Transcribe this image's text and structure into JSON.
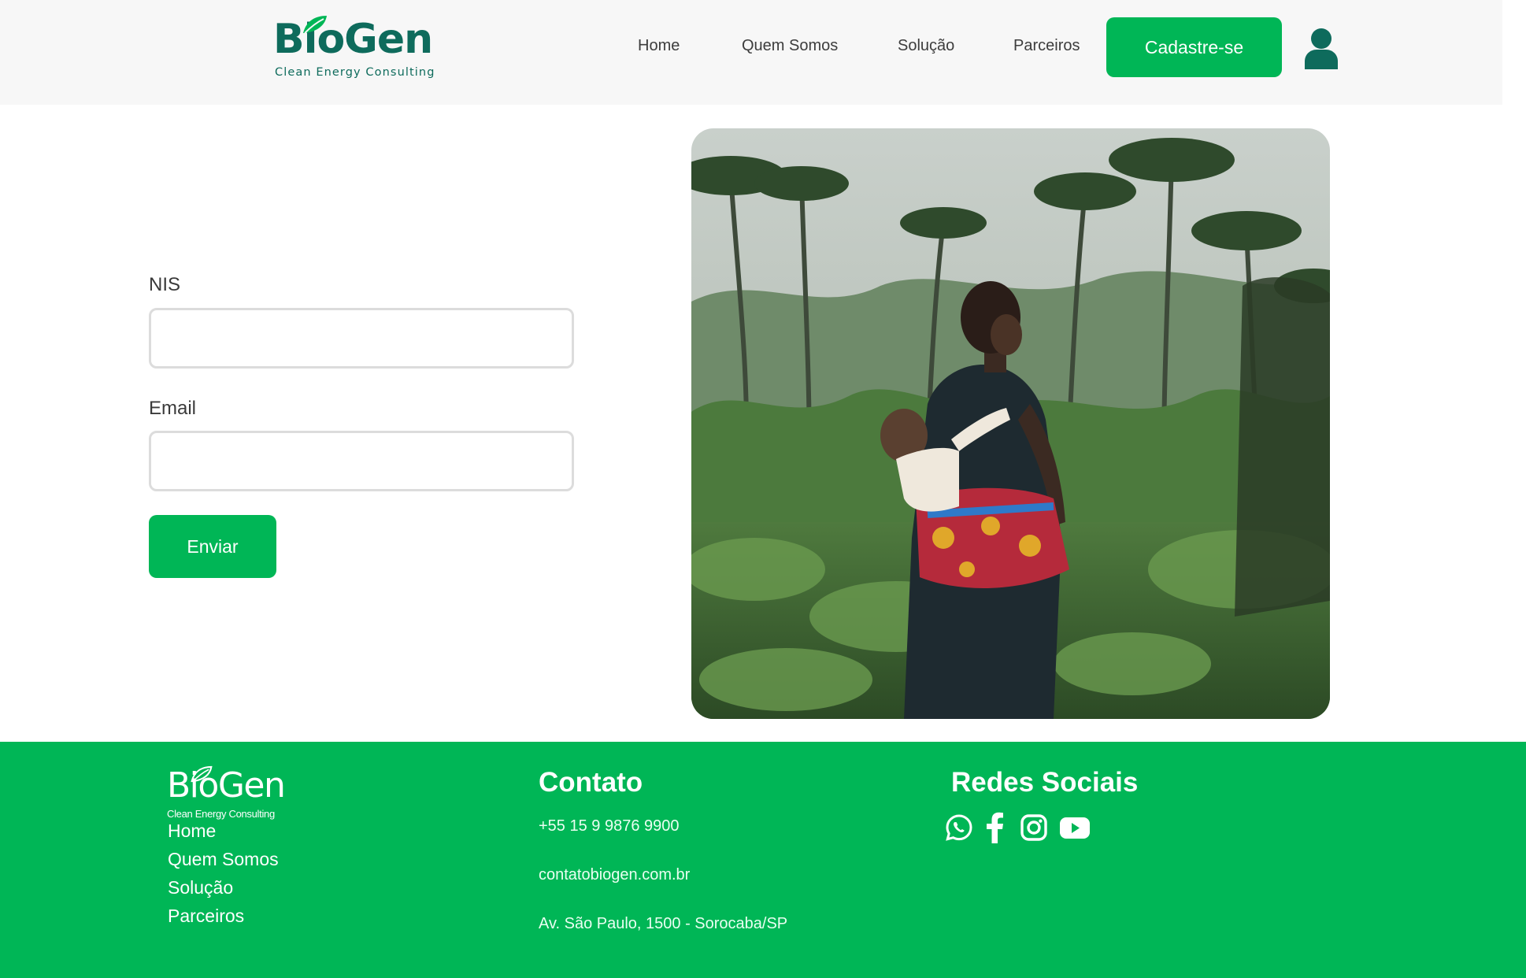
{
  "header": {
    "logo_text": "BioGen",
    "logo_tagline": "Clean Energy Consulting",
    "nav": [
      "Home",
      "Quem Somos",
      "Solução",
      "Parceiros"
    ],
    "signup_label": "Cadastre-se"
  },
  "form": {
    "nis_label": "NIS",
    "nis_value": "",
    "email_label": "Email",
    "email_value": "",
    "submit_label": "Enviar"
  },
  "footer": {
    "logo_text": "BioGen",
    "logo_tagline": "Clean Energy Consulting",
    "nav": [
      "Home",
      "Quem Somos",
      "Solução",
      "Parceiros"
    ],
    "contact_heading": "Contato",
    "phone": "+55 15 9 9876 9900",
    "email": "contatobiogen.com.br",
    "address": "Av. São Paulo, 1500 - Sorocaba/SP",
    "social_heading": "Redes Sociais",
    "social_icons": [
      "whatsapp-icon",
      "facebook-icon",
      "instagram-icon",
      "youtube-icon"
    ]
  },
  "colors": {
    "brand_green": "#00b656",
    "logo_teal": "#0e6b5c",
    "header_bg": "#f7f7f7"
  }
}
